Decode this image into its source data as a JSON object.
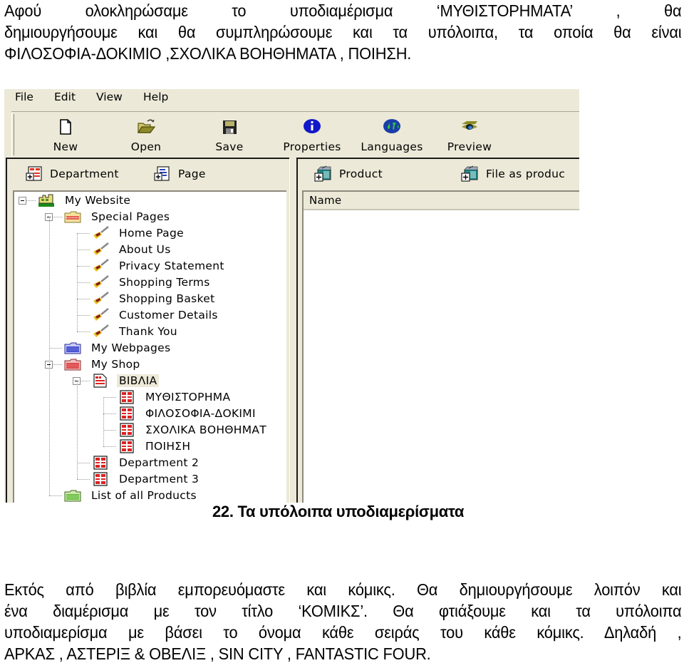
{
  "intro_paragraph": {
    "lines": [
      "Αφού ολοκληρώσαμε το υποδιαμέρισμα ‘ΜΥΘΙΣΤΟΡΗΜΑΤΑ’ , θα",
      "δημιουργήσουμε και θα συμπληρώσουμε και τα υπόλοιπα, τα οποία θα είναι",
      "ΦΙΛΟΣΟΦΙΑ-ΔΟΚΙΜΙΟ ,ΣΧΟΛΙΚΑ ΒΟΗΘΗΜΑΤΑ , ΠΟΙΗΣΗ."
    ]
  },
  "app": {
    "menu": [
      "File",
      "Edit",
      "View",
      "Help"
    ],
    "toolbar": [
      {
        "label": "New",
        "icon": "new-document-icon"
      },
      {
        "label": "Open",
        "icon": "open-folder-icon"
      },
      {
        "label": "Save",
        "icon": "floppy-disk-icon"
      },
      {
        "label": "Properties",
        "icon": "info-icon"
      },
      {
        "label": "Languages",
        "icon": "globe-icon"
      },
      {
        "label": "Preview",
        "icon": "eye-icon"
      }
    ],
    "left_pane": {
      "buttons": [
        {
          "label": "Department",
          "icon": "add-department-icon"
        },
        {
          "label": "Page",
          "icon": "add-page-icon"
        }
      ],
      "tree": [
        {
          "label": "My Website",
          "icon": "website-icon",
          "level": 0,
          "expanded": true
        },
        {
          "label": "Special Pages",
          "icon": "special-folder-icon",
          "level": 1,
          "expanded": true
        },
        {
          "label": "Home Page",
          "icon": "special-page-icon",
          "level": 2
        },
        {
          "label": "About Us",
          "icon": "special-page-icon",
          "level": 2
        },
        {
          "label": "Privacy Statement",
          "icon": "special-page-icon",
          "level": 2
        },
        {
          "label": "Shopping Terms",
          "icon": "special-page-icon",
          "level": 2
        },
        {
          "label": "Shopping Basket",
          "icon": "special-page-icon",
          "level": 2
        },
        {
          "label": "Customer Details",
          "icon": "special-page-icon",
          "level": 2
        },
        {
          "label": "Thank You",
          "icon": "special-page-icon",
          "level": 2
        },
        {
          "label": "My Webpages",
          "icon": "webpages-folder-icon",
          "level": 1
        },
        {
          "label": "My Shop",
          "icon": "shop-folder-icon",
          "level": 1,
          "expanded": true
        },
        {
          "label": "ΒΙΒΛΙΑ",
          "icon": "department-page-icon",
          "level": 2,
          "expanded": true,
          "selected": true
        },
        {
          "label": "ΜΥΘΙΣΤΟΡΗΜΑ",
          "icon": "department-icon",
          "level": 3
        },
        {
          "label": "ΦΙΛΟΣΟΦΙΑ-ΔΟΚΙΜΙ",
          "icon": "department-icon",
          "level": 3
        },
        {
          "label": "ΣΧΟΛΙΚΑ ΒΟΗΘΗΜΑΤ",
          "icon": "department-icon",
          "level": 3
        },
        {
          "label": "ΠΟΙΗΣΗ",
          "icon": "department-icon",
          "level": 3
        },
        {
          "label": "Department 2",
          "icon": "department-icon",
          "level": 2
        },
        {
          "label": "Department 3",
          "icon": "department-icon",
          "level": 2
        },
        {
          "label": "List of all Products",
          "icon": "products-folder-icon",
          "level": 1
        }
      ]
    },
    "right_pane": {
      "buttons": [
        {
          "label": "Product",
          "icon": "add-product-icon"
        },
        {
          "label": "File as produc",
          "icon": "add-file-product-icon"
        }
      ],
      "columns": [
        "Name"
      ]
    }
  },
  "caption": "22. Τα υπόλοιπα υποδιαμερίσματα",
  "closing_paragraph": {
    "lines": [
      "Εκτός από βιβλία εμπορευόμαστε και κόμικς. Θα δημιουργήσουμε  λοιπόν και",
      "ένα διαμέρισμα με τον τίτλο ‘ΚΟΜΙΚΣ’. Θα φτιάξουμε και τα υπόλοιπα",
      "υποδιαμερίσμα με βάσει το όνομα κάθε σειράς του κάθε κόμικς. Δηλαδή ,",
      "ΑΡΚΑΣ , ΑΣΤΕΡΙΞ & ΟΒΕΛΙΞ , SIN CITY , FANTASTIC FOUR."
    ]
  }
}
